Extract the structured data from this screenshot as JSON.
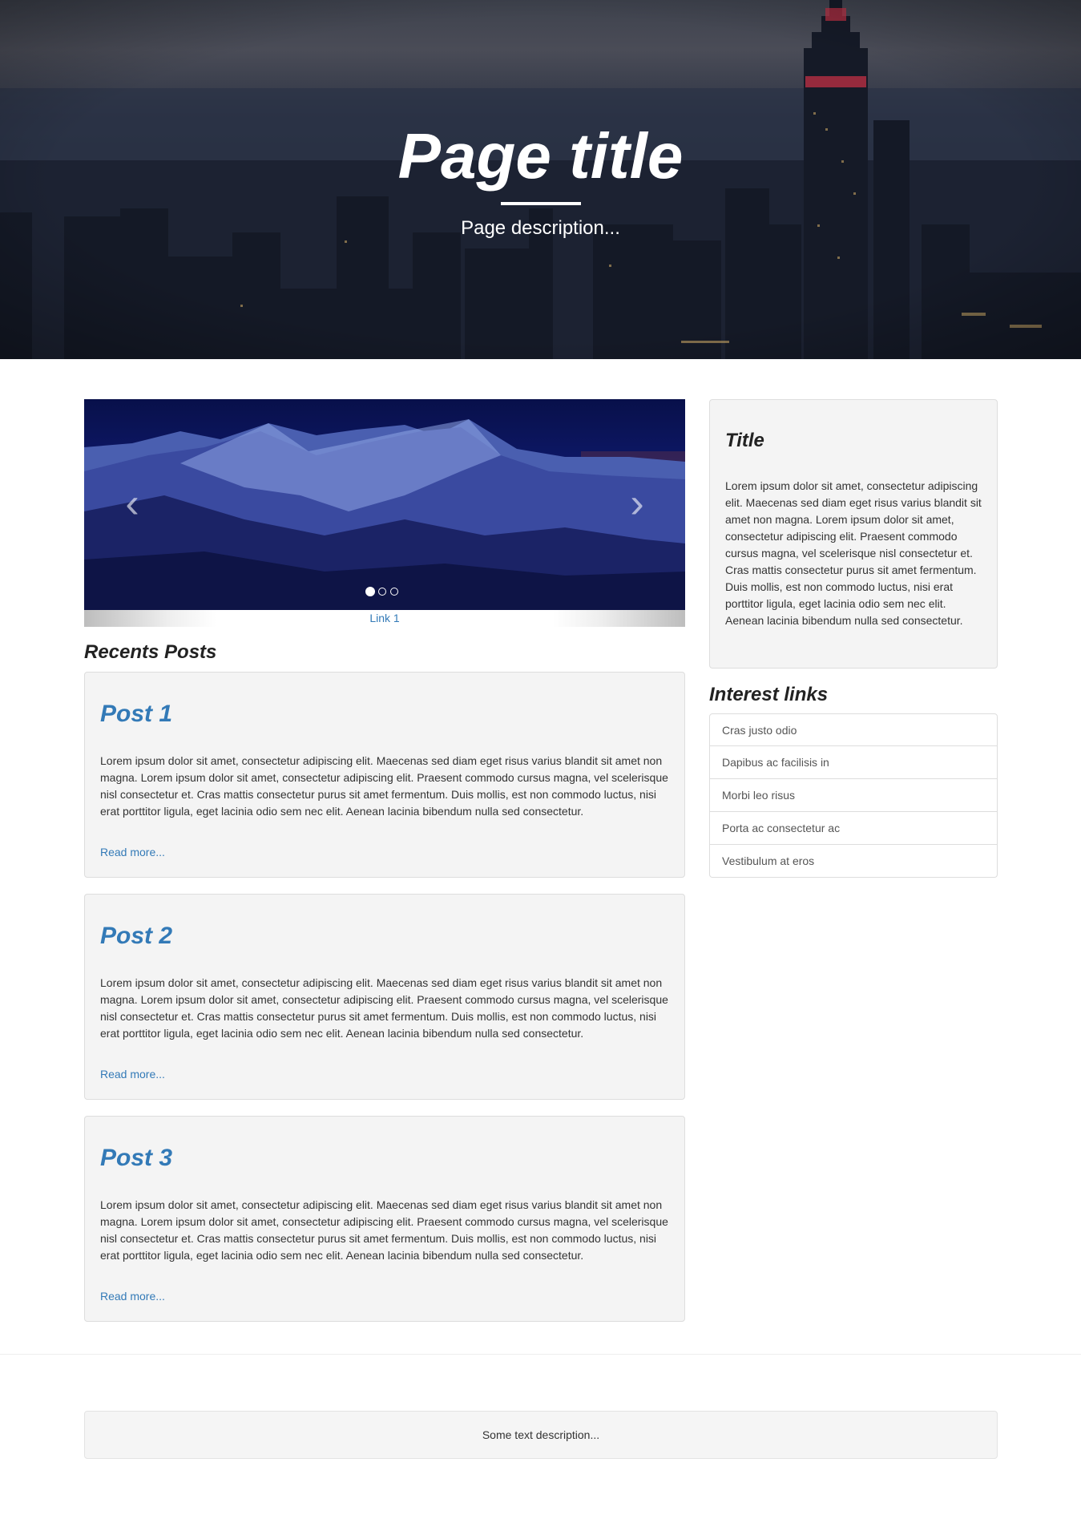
{
  "hero": {
    "title": "Page title",
    "description": "Page description..."
  },
  "carousel": {
    "caption_link": "Link 1",
    "slide_count": 3,
    "active_index": 0,
    "prev_icon": "chevron-left-icon",
    "next_icon": "chevron-right-icon"
  },
  "posts_section": {
    "heading": "Recents Posts",
    "posts": [
      {
        "title": "Post 1",
        "body": "Lorem ipsum dolor sit amet, consectetur adipiscing elit. Maecenas sed diam eget risus varius blandit sit amet non magna. Lorem ipsum dolor sit amet, consectetur adipiscing elit. Praesent commodo cursus magna, vel scelerisque nisl consectetur et. Cras mattis consectetur purus sit amet fermentum. Duis mollis, est non commodo luctus, nisi erat porttitor ligula, eget lacinia odio sem nec elit. Aenean lacinia bibendum nulla sed consectetur.",
        "read_more": "Read more..."
      },
      {
        "title": "Post 2",
        "body": "Lorem ipsum dolor sit amet, consectetur adipiscing elit. Maecenas sed diam eget risus varius blandit sit amet non magna. Lorem ipsum dolor sit amet, consectetur adipiscing elit. Praesent commodo cursus magna, vel scelerisque nisl consectetur et. Cras mattis consectetur purus sit amet fermentum. Duis mollis, est non commodo luctus, nisi erat porttitor ligula, eget lacinia odio sem nec elit. Aenean lacinia bibendum nulla sed consectetur.",
        "read_more": "Read more..."
      },
      {
        "title": "Post 3",
        "body": "Lorem ipsum dolor sit amet, consectetur adipiscing elit. Maecenas sed diam eget risus varius blandit sit amet non magna. Lorem ipsum dolor sit amet, consectetur adipiscing elit. Praesent commodo cursus magna, vel scelerisque nisl consectetur et. Cras mattis consectetur purus sit amet fermentum. Duis mollis, est non commodo luctus, nisi erat porttitor ligula, eget lacinia odio sem nec elit. Aenean lacinia bibendum nulla sed consectetur.",
        "read_more": "Read more..."
      }
    ]
  },
  "sidebar": {
    "title": "Title",
    "body": "Lorem ipsum dolor sit amet, consectetur adipiscing elit. Maecenas sed diam eget risus varius blandit sit amet non magna. Lorem ipsum dolor sit amet, consectetur adipiscing elit. Praesent commodo cursus magna, vel scelerisque nisl consectetur et. Cras mattis consectetur purus sit amet fermentum. Duis mollis, est non commodo luctus, nisi erat porttitor ligula, eget lacinia odio sem nec elit. Aenean lacinia bibendum nulla sed consectetur.",
    "links_heading": "Interest links",
    "links": [
      "Cras justo odio",
      "Dapibus ac facilisis in",
      "Morbi leo risus",
      "Porta ac consectetur ac",
      "Vestibulum at eros"
    ]
  },
  "footer": {
    "text": "Some text description..."
  },
  "colors": {
    "link": "#337ab7",
    "panel_bg": "#f4f4f4",
    "panel_border": "#dddddd"
  }
}
